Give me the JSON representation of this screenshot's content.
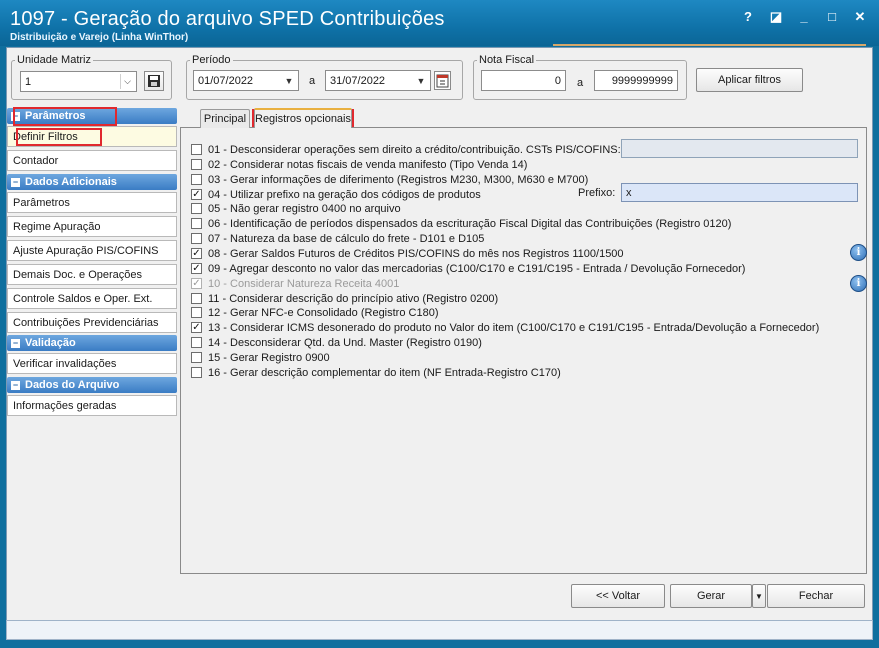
{
  "window": {
    "title": "1097 - Geração do arquivo SPED Contribuições",
    "subtitle": "Distribuição e Varejo (Linha WinThor)",
    "controls": {
      "help": "?",
      "restore": "◪",
      "minimize": "_",
      "maximize": "□",
      "close": "✕"
    }
  },
  "filters": {
    "unidade_label": "Unidade Matriz",
    "unidade_value": "1",
    "periodo_label": "Período",
    "date_from": "01/07/2022",
    "date_sep": "a",
    "date_to": "31/07/2022",
    "nota_label": "Nota Fiscal",
    "nota_from": "0",
    "nota_sep": "a",
    "nota_to": "9999999999",
    "apply_button": "Aplicar filtros"
  },
  "sidebar": {
    "sections": [
      {
        "header": "Parâmetros",
        "items": [
          "Definir Filtros",
          "Contador"
        ]
      },
      {
        "header": "Dados Adicionais",
        "items": [
          "Parâmetros",
          "Regime Apuração",
          "Ajuste Apuração PIS/COFINS",
          "Demais Doc. e Operações",
          "Controle Saldos e Oper. Ext.",
          "Contribuições Previdenciárias"
        ]
      },
      {
        "header": "Validação",
        "items": [
          "Verificar invalidações"
        ]
      },
      {
        "header": "Dados do Arquivo",
        "items": [
          "Informações geradas"
        ]
      }
    ]
  },
  "tabs": [
    "Principal",
    "Registros opcionais"
  ],
  "options": [
    {
      "label": "01 - Desconsiderar operações sem direito a crédito/contribuição. CSTs PIS/COFINS:",
      "checked": false,
      "enabled": true
    },
    {
      "label": "02 - Considerar notas fiscais de venda manifesto (Tipo Venda 14)",
      "checked": false,
      "enabled": true
    },
    {
      "label": "03 - Gerar informações de diferimento (Registros M230, M300, M630 e M700)",
      "checked": false,
      "enabled": true
    },
    {
      "label": "04 - Utilizar prefixo na geração dos códigos de produtos",
      "checked": true,
      "enabled": true
    },
    {
      "label": "05 - Não gerar registro 0400 no arquivo",
      "checked": false,
      "enabled": true
    },
    {
      "label": "06 - Identificação de períodos dispensados da escrituração Fiscal Digital das Contribuições (Registro 0120)",
      "checked": false,
      "enabled": true
    },
    {
      "label": "07 - Natureza da base de cálculo do frete - D101 e D105",
      "checked": false,
      "enabled": true
    },
    {
      "label": "08 - Gerar Saldos Futuros de Créditos PIS/COFINS do mês nos Registros 1100/1500",
      "checked": true,
      "enabled": true
    },
    {
      "label": "09 - Agregar desconto no valor das mercadorias (C100/C170 e C191/C195 - Entrada / Devolução Fornecedor)",
      "checked": true,
      "enabled": true
    },
    {
      "label": "10 - Considerar Natureza Receita 4001",
      "checked": true,
      "enabled": false
    },
    {
      "label": "11 - Considerar descrição do princípio ativo (Registro 0200)",
      "checked": false,
      "enabled": true
    },
    {
      "label": "12 - Gerar NFC-e Consolidado (Registro C180)",
      "checked": false,
      "enabled": true
    },
    {
      "label": "13 - Considerar ICMS desonerado do produto no Valor do item (C100/C170 e C191/C195 - Entrada/Devolução a Fornecedor)",
      "checked": true,
      "enabled": true
    },
    {
      "label": "14 - Desconsiderar Qtd. da Und. Master (Registro 0190)",
      "checked": false,
      "enabled": true
    },
    {
      "label": "15 - Gerar Registro 0900",
      "checked": false,
      "enabled": true
    },
    {
      "label": "16 - Gerar descrição complementar do item (NF Entrada-Registro C170)",
      "checked": false,
      "enabled": true
    }
  ],
  "csts_value": "",
  "prefix_label": "Prefixo:",
  "prefix_value": "x",
  "info_glyph": "i",
  "check_glyph": "✓",
  "buttons": {
    "voltar": "<< Voltar",
    "gerar": "Gerar",
    "fechar": "Fechar"
  },
  "icons": {
    "save": "save-icon",
    "calendar": "calendar-icon",
    "info": "info-icon"
  },
  "colors": {
    "title_bar": "#0f72a8",
    "section_header": "#3a7cc4",
    "highlight": "#e0282e"
  }
}
